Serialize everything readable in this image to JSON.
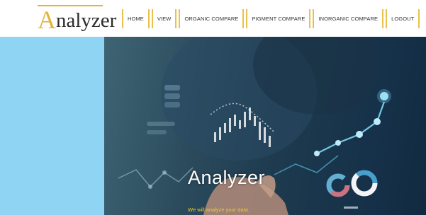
{
  "logo": {
    "initial": "A",
    "rest": "nalyzer"
  },
  "nav": {
    "items": [
      {
        "label": "HOME"
      },
      {
        "label": "VIEW"
      },
      {
        "label": "ORGANIC COMPARE"
      },
      {
        "label": "PIGMENT COMPARE"
      },
      {
        "label": "INORGANIC COMPARE"
      },
      {
        "label": "LOGOUT"
      }
    ]
  },
  "hero": {
    "title": "Analyzer",
    "subtitle": "We will analyze your data."
  },
  "colors": {
    "accent": "#e8c24c",
    "sidebar_blue": "#8fd4f2",
    "subtitle_yellow": "#f0c93a"
  }
}
